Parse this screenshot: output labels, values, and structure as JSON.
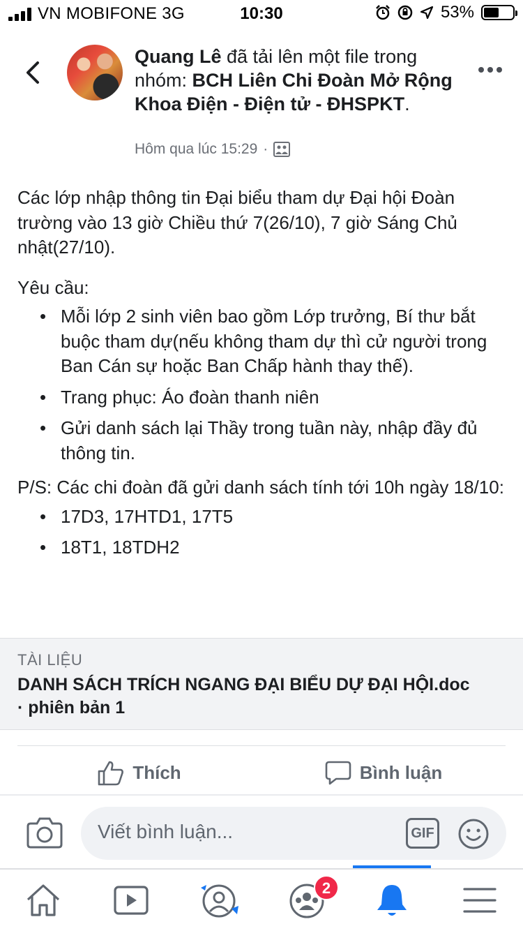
{
  "status_bar": {
    "carrier": "VN MOBIFONE 3G",
    "time": "10:30",
    "battery_percent": "53%",
    "battery_level": 0.53
  },
  "post": {
    "author": "Quang Lê",
    "action_text": " đã tải lên một file trong nhóm: ",
    "group_name": "BCH Liên Chi Đoàn Mở Rộng Khoa Điện - Điện tử - ĐHSPKT",
    "period": ".",
    "timestamp": "Hôm qua lúc 15:29",
    "meta_separator": "·",
    "paragraph_1": "Các lớp nhập thông tin Đại biểu tham dự Đại hội Đoàn trường vào 13 giờ Chiều thứ 7(26/10), 7 giờ Sáng Chủ nhật(27/10).",
    "requirements_heading": "Yêu cầu:",
    "requirements": [
      "Mỗi lớp 2 sinh viên bao gồm Lớp trưởng, Bí thư bắt buộc tham dự(nếu không tham dự thì cử người trong Ban Cán sự hoặc Ban Chấp hành thay thế).",
      "Trang phục: Áo đoàn thanh niên",
      "Gửi danh sách lại Thầy trong tuần này, nhập đầy đủ thông tin."
    ],
    "ps_text": "P/S: Các chi đoàn đã gửi danh sách tính tới 10h ngày 18/10:",
    "ps_items": [
      "17D3, 17HTD1, 17T5",
      "18T1, 18TDH2"
    ]
  },
  "attachment": {
    "label": "TÀI LIỆU",
    "filename": "DANH SÁCH TRÍCH NGANG ĐẠI BIỂU DỰ ĐẠI HỘI.doc",
    "version": " · phiên bản 1"
  },
  "actions": {
    "like": "Thích",
    "comment": "Bình luận"
  },
  "comment_bar": {
    "placeholder": "Viết bình luận...",
    "gif_label": "GIF"
  },
  "tab_bar": {
    "groups_badge": "2",
    "active_tab": "notifications"
  },
  "colors": {
    "accent": "#1877f2",
    "badge": "#f02849",
    "attachment_bg": "#f2f3f5"
  }
}
